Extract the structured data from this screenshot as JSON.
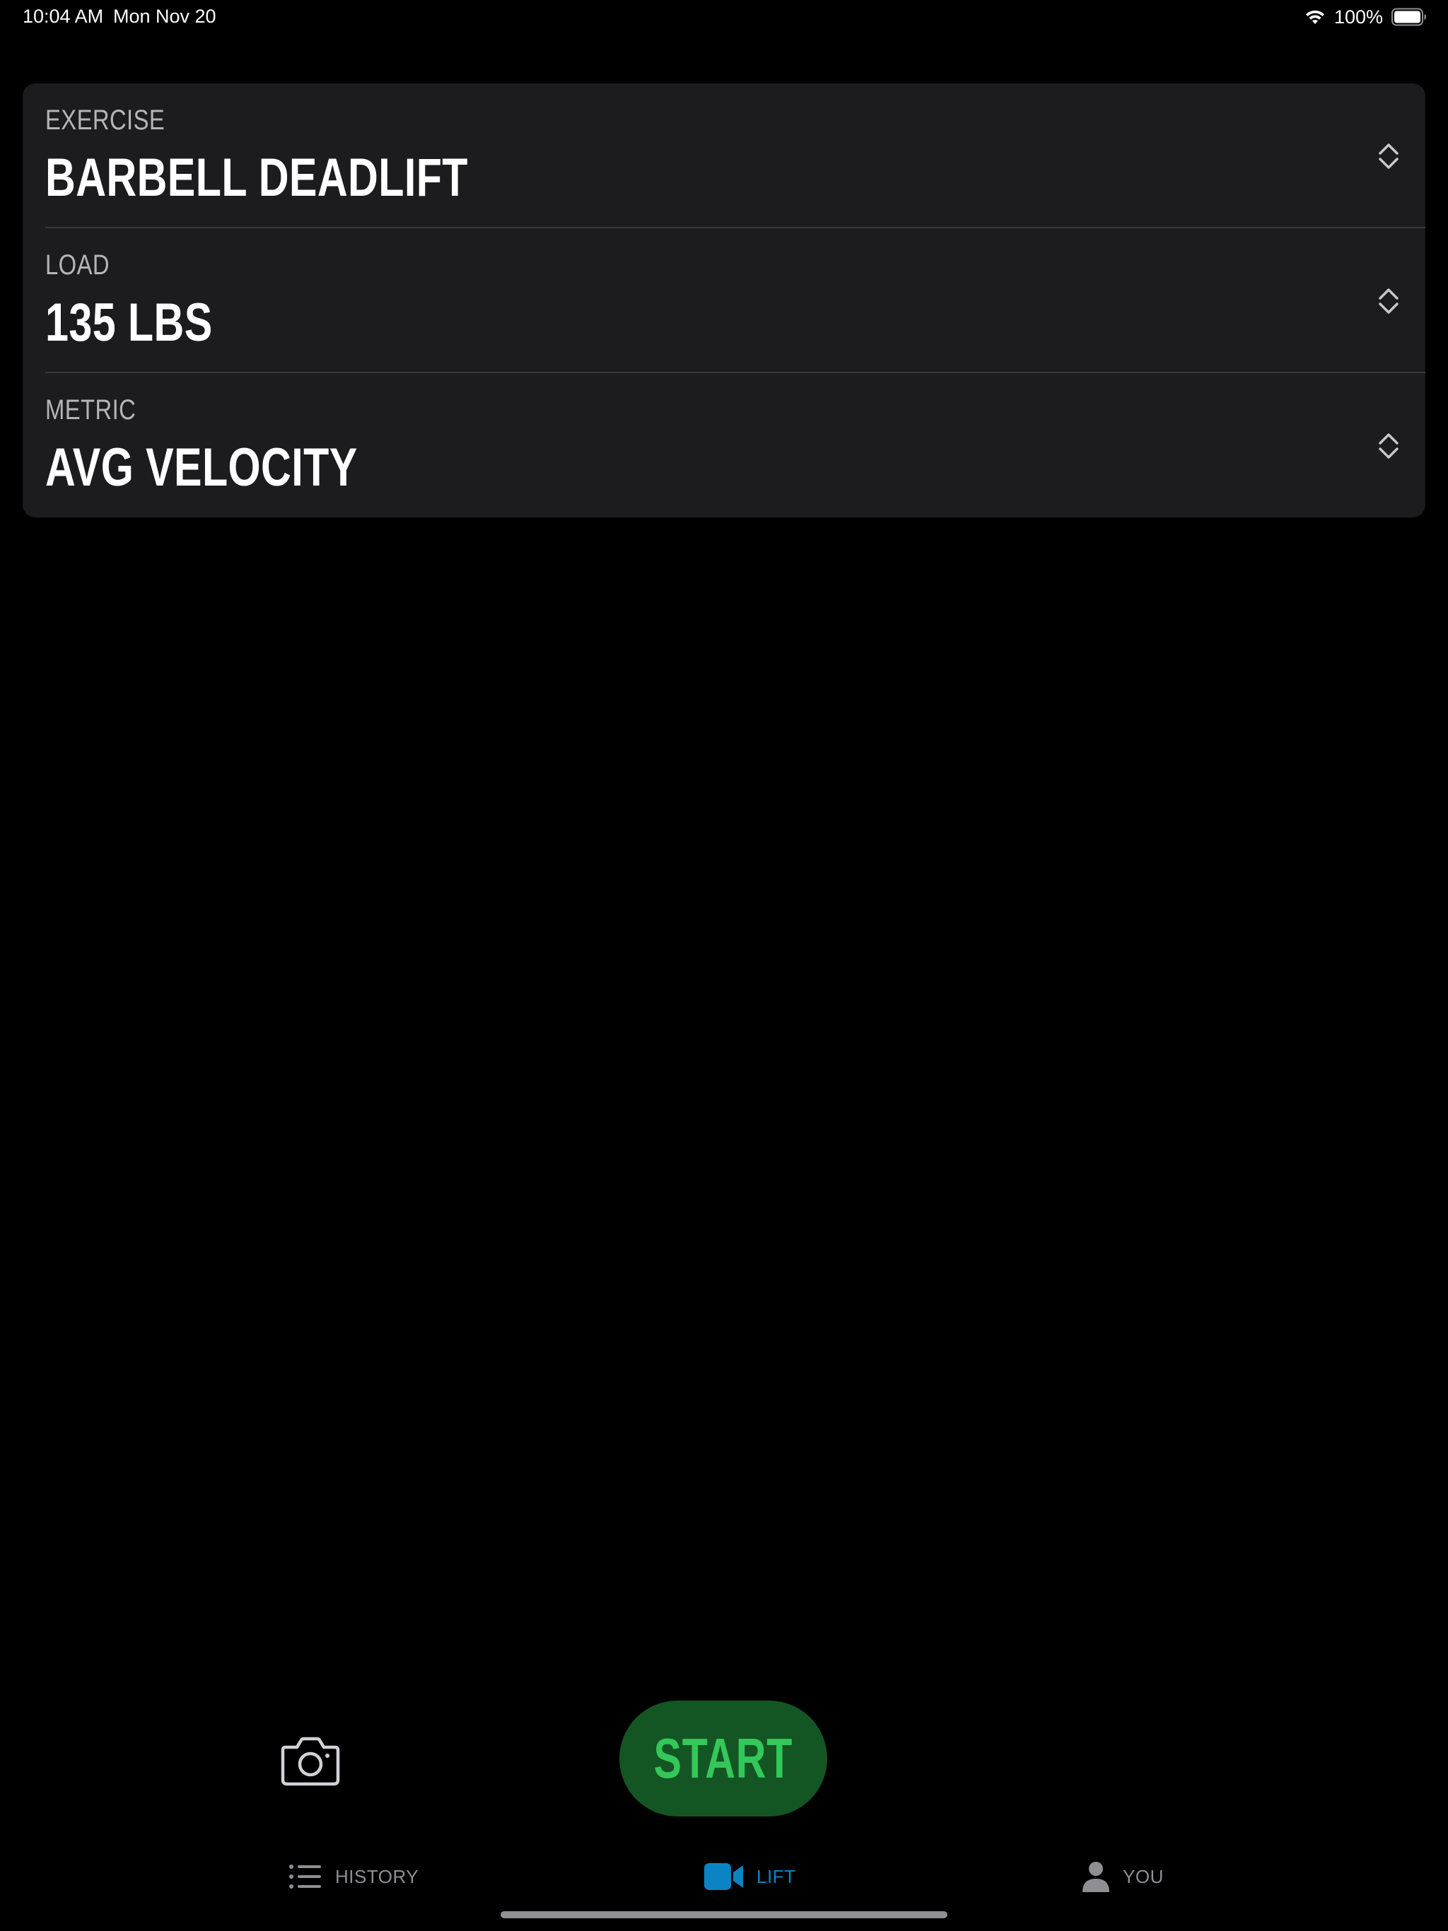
{
  "status_bar": {
    "time": "10:04 AM",
    "date": "Mon Nov 20",
    "battery_percent": "100%",
    "battery_level": 1.0,
    "icons": [
      "wifi-icon",
      "battery-icon"
    ]
  },
  "settings": {
    "rows": [
      {
        "label": "EXERCISE",
        "value": "BARBELL DEADLIFT"
      },
      {
        "label": "LOAD",
        "value": "135 LBS"
      },
      {
        "label": "METRIC",
        "value": "AVG VELOCITY"
      }
    ],
    "row_icon": "chevron-up-down-icon"
  },
  "controls": {
    "camera_icon": "camera-icon",
    "start_label": "START"
  },
  "tab_bar": {
    "selected": "LIFT",
    "items": [
      {
        "label": "HISTORY",
        "icon": "list-icon"
      },
      {
        "label": "LIFT",
        "icon": "video-camera-icon"
      },
      {
        "label": "YOU",
        "icon": "person-icon"
      }
    ]
  },
  "colors": {
    "background": "#000000",
    "card": "#1c1c1e",
    "divider": "#38383a",
    "label_gray": "#b5b5b8",
    "start_bg": "#145524",
    "start_text": "#34c759",
    "tab_selected": "#0a84c4",
    "tab_inactive": "#8e8e93"
  }
}
